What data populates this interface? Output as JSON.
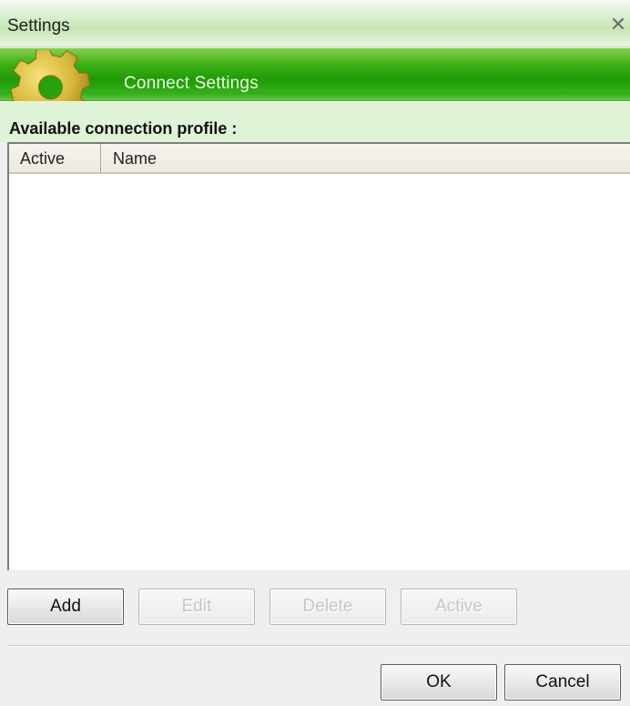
{
  "window": {
    "title": "Settings",
    "close_icon": "close-icon"
  },
  "banner": {
    "icon": "gear-icon",
    "label": "Connect Settings"
  },
  "profiles": {
    "heading": "Available connection profile :",
    "columns": [
      "Active",
      "Name"
    ],
    "rows": []
  },
  "buttons": {
    "add": "Add",
    "edit": "Edit",
    "delete": "Delete",
    "active": "Active",
    "ok": "OK",
    "cancel": "Cancel"
  },
  "colors": {
    "banner_green": "#1f9a06",
    "section_bg": "#dff3d6",
    "disabled_text": "#c6c6c6"
  }
}
